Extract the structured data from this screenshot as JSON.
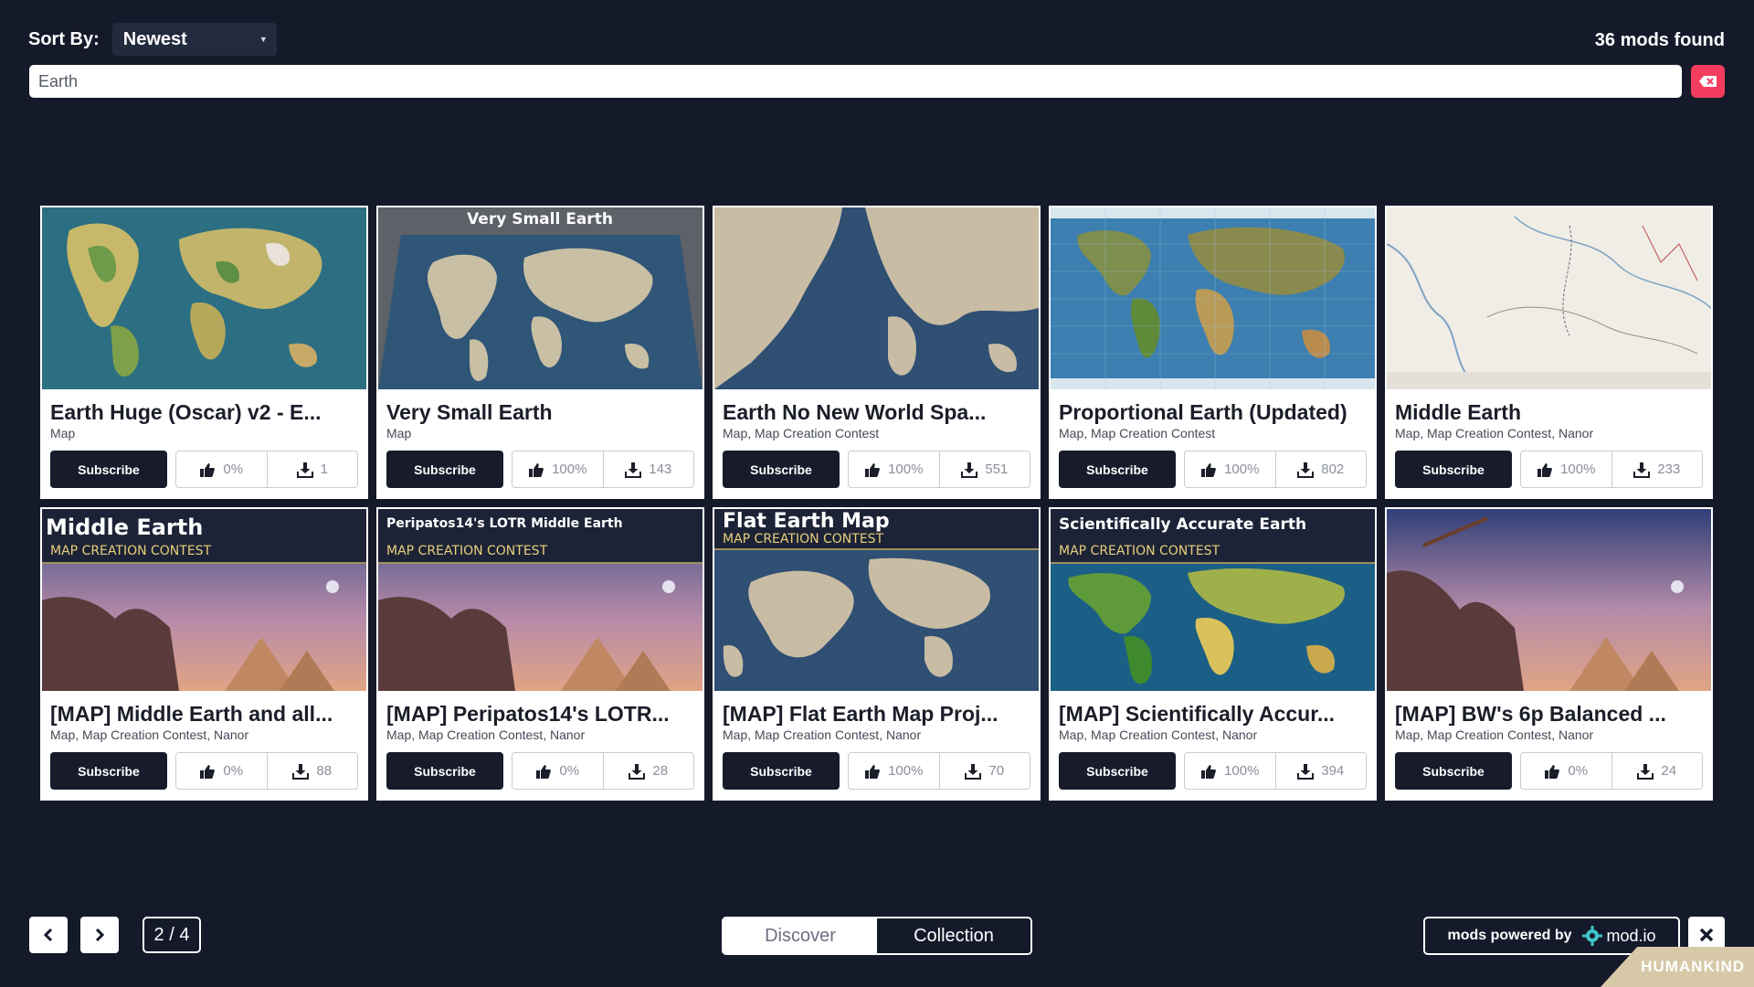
{
  "toolbar": {
    "sort_label": "Sort By:",
    "sort_value": "Newest",
    "mods_found": "36 mods found"
  },
  "search": {
    "value": "Earth"
  },
  "cards": [
    {
      "title": "Earth Huge (Oscar) v2 - E...",
      "tags": "Map",
      "subscribe": "Subscribe",
      "rating": "0%",
      "downloads": "1",
      "banner": "",
      "subtitle": ""
    },
    {
      "title": "Very Small Earth",
      "tags": "Map",
      "subscribe": "Subscribe",
      "rating": "100%",
      "downloads": "143",
      "banner": "Very Small Earth",
      "subtitle": ""
    },
    {
      "title": "Earth No New World Spa...",
      "tags": "Map, Map Creation Contest",
      "subscribe": "Subscribe",
      "rating": "100%",
      "downloads": "551",
      "banner": "",
      "subtitle": ""
    },
    {
      "title": "Proportional Earth (Updated)",
      "tags": "Map, Map Creation Contest",
      "subscribe": "Subscribe",
      "rating": "100%",
      "downloads": "802",
      "banner": "",
      "subtitle": ""
    },
    {
      "title": "Middle Earth",
      "tags": "Map, Map Creation Contest, Nanor",
      "subscribe": "Subscribe",
      "rating": "100%",
      "downloads": "233",
      "banner": "",
      "subtitle": ""
    },
    {
      "title": "[MAP] Middle Earth and all...",
      "tags": "Map, Map Creation Contest, Nanor",
      "subscribe": "Subscribe",
      "rating": "0%",
      "downloads": "88",
      "banner": "Middle Earth",
      "subtitle": "MAP CREATION CONTEST"
    },
    {
      "title": "[MAP] Peripatos14's LOTR...",
      "tags": "Map, Map Creation Contest, Nanor",
      "subscribe": "Subscribe",
      "rating": "0%",
      "downloads": "28",
      "banner": "Peripatos14's LOTR Middle Earth",
      "subtitle": "MAP CREATION CONTEST"
    },
    {
      "title": "[MAP] Flat Earth Map Proj...",
      "tags": "Map, Map Creation Contest, Nanor",
      "subscribe": "Subscribe",
      "rating": "100%",
      "downloads": "70",
      "banner": "Flat Earth Map",
      "subtitle": "MAP CREATION CONTEST"
    },
    {
      "title": "[MAP] Scientifically Accur...",
      "tags": "Map, Map Creation Contest, Nanor",
      "subscribe": "Subscribe",
      "rating": "100%",
      "downloads": "394",
      "banner": "Scientifically Accurate Earth",
      "subtitle": "MAP CREATION CONTEST"
    },
    {
      "title": "[MAP] BW's 6p Balanced ...",
      "tags": "Map, Map Creation Contest, Nanor",
      "subscribe": "Subscribe",
      "rating": "0%",
      "downloads": "24",
      "banner": "",
      "subtitle": ""
    }
  ],
  "pagination": {
    "indicator": "2 / 4"
  },
  "tabs": {
    "discover": "Discover",
    "collection": "Collection"
  },
  "footer": {
    "powered_by": "mods powered by",
    "modio": "mod.io",
    "brand": "HUMANKIND"
  },
  "icons": {
    "prev": "chevron-left-icon",
    "next": "chevron-right-icon",
    "close": "close-icon",
    "clear": "clear-search-icon",
    "thumbs": "thumbs-up-icon",
    "download": "download-icon"
  },
  "colors": {
    "background": "#151a2b",
    "accent": "#f33d5e",
    "button_dark": "#171b2b",
    "card": "#ffffff"
  }
}
